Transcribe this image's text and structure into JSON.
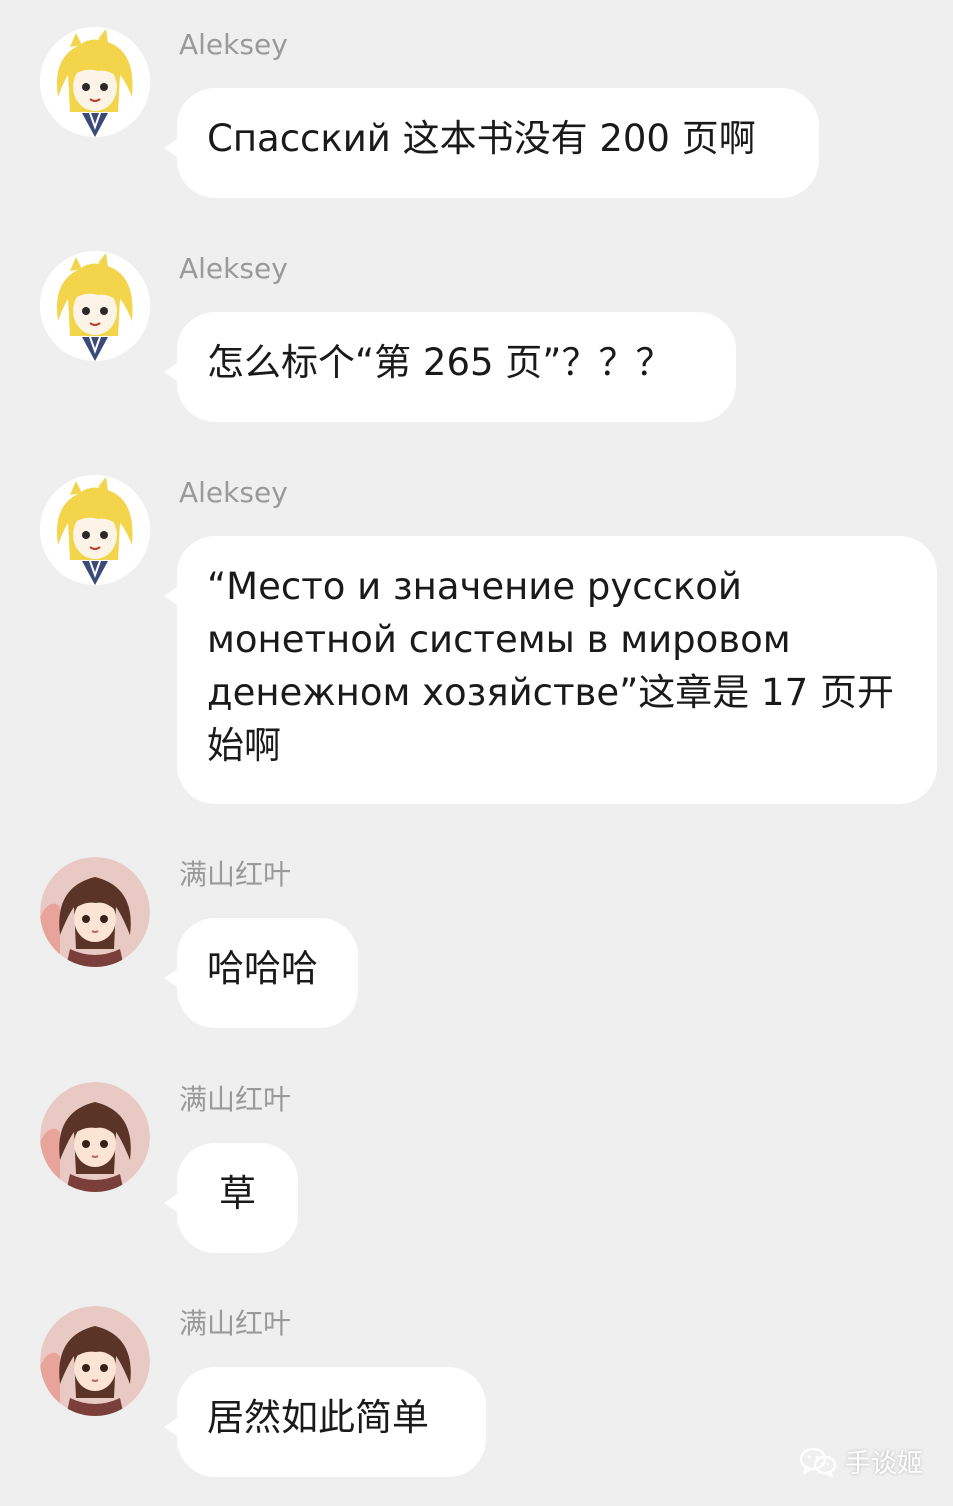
{
  "colors": {
    "background": "#efefef",
    "bubble": "#ffffff",
    "sender_name": "#9a9a9a",
    "text": "#1a1a1a"
  },
  "messages": [
    {
      "sender": "Aleksey",
      "avatar": "blonde-anime-avatar",
      "text": "Спасский 这本书没有 200 页啊"
    },
    {
      "sender": "Aleksey",
      "avatar": "blonde-anime-avatar",
      "text": "怎么标个“第 265 页”？？？"
    },
    {
      "sender": "Aleksey",
      "avatar": "blonde-anime-avatar",
      "text": "“Место и значение русской монетной системы в мировом денежном хозяйстве”这章是 17 页开始啊"
    },
    {
      "sender": "满山红叶",
      "avatar": "brunette-anime-avatar",
      "text": "哈哈哈"
    },
    {
      "sender": "满山红叶",
      "avatar": "brunette-anime-avatar",
      "text": "草"
    },
    {
      "sender": "满山红叶",
      "avatar": "brunette-anime-avatar",
      "text": "居然如此简单"
    }
  ],
  "watermark": {
    "icon": "wechat-icon",
    "text": "手谈姬"
  }
}
